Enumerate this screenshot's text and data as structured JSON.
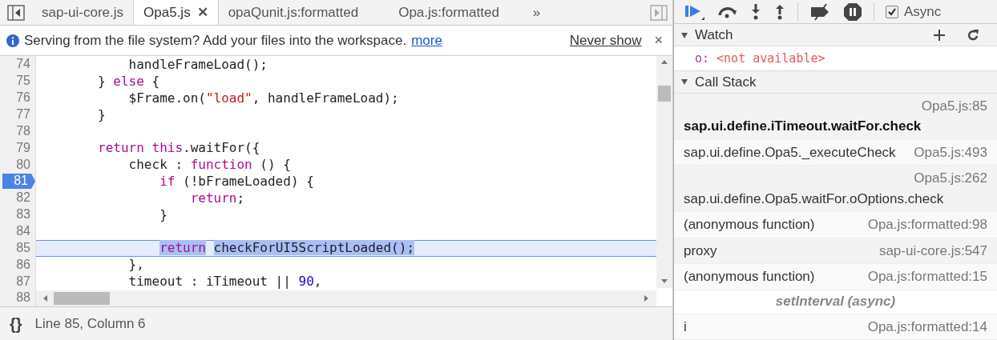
{
  "editor": {
    "tabs": [
      {
        "label": "sap-ui-core.js",
        "selected": false
      },
      {
        "label": "Opa5.js",
        "selected": true,
        "close": "✕"
      },
      {
        "label": "opaQunit.js:formatted",
        "selected": false
      },
      {
        "label": "Opa.js:formatted",
        "selected": false
      }
    ],
    "more_tabs": "»",
    "infobar": {
      "message": "Serving from the file system? Add your files into the workspace.",
      "link": "more",
      "dismiss": "Never show",
      "close": "×"
    },
    "lines": [
      {
        "number": "74",
        "tokens": [
          {
            "kind": "plain",
            "text": "            handleFrameLoad();"
          }
        ]
      },
      {
        "number": "75",
        "tokens": [
          {
            "kind": "plain",
            "text": "        } "
          },
          {
            "kind": "keyword",
            "text": "else"
          },
          {
            "kind": "plain",
            "text": " {"
          }
        ]
      },
      {
        "number": "76",
        "tokens": [
          {
            "kind": "plain",
            "text": "            $Frame.on("
          },
          {
            "kind": "string",
            "text": "\"load\""
          },
          {
            "kind": "plain",
            "text": ", handleFrameLoad);"
          }
        ]
      },
      {
        "number": "77",
        "tokens": [
          {
            "kind": "plain",
            "text": "        }"
          }
        ]
      },
      {
        "number": "78"
      },
      {
        "number": "79",
        "tokens": [
          {
            "kind": "keyword",
            "text": "        return this"
          },
          {
            "kind": "plain",
            "text": ".waitFor({"
          }
        ]
      },
      {
        "number": "80",
        "tokens": [
          {
            "kind": "plain",
            "text": "            check : "
          },
          {
            "kind": "keyword",
            "text": "function"
          },
          {
            "kind": "plain",
            "text": " () {"
          }
        ]
      },
      {
        "number": "81",
        "breakpoint": true,
        "current": false,
        "tokens": [
          {
            "kind": "keyword",
            "text": "                if"
          },
          {
            "kind": "plain",
            "text": " (!bFrameLoaded) {"
          }
        ]
      },
      {
        "number": "82",
        "tokens": [
          {
            "kind": "keyword",
            "text": "                    return"
          },
          {
            "kind": "plain",
            "text": ";"
          }
        ]
      },
      {
        "number": "83",
        "tokens": [
          {
            "kind": "plain",
            "text": "                }"
          }
        ]
      },
      {
        "number": "84"
      },
      {
        "number": "85",
        "breakpoint": false,
        "current": true,
        "tokens": [
          {
            "kind": "keyword",
            "text": "                return",
            "selected": true
          },
          {
            "kind": "plain",
            "text": " checkForUI5ScriptLoaded();",
            "selected": true
          }
        ]
      },
      {
        "number": "86",
        "tokens": [
          {
            "kind": "plain",
            "text": "            },"
          }
        ]
      },
      {
        "number": "87",
        "tokens": [
          {
            "kind": "plain",
            "text": "            timeout : iTimeout || "
          },
          {
            "kind": "number",
            "text": "90"
          },
          {
            "kind": "plain",
            "text": ","
          }
        ]
      },
      {
        "number": "88"
      }
    ],
    "format_button": "{}",
    "status": "Line 85, Column 6"
  },
  "debugger": {
    "async": {
      "label": "Async",
      "checked": true
    },
    "watch": {
      "title": "Watch",
      "expanded": true,
      "items": [
        {
          "name": "o:",
          "value": "<not available>"
        }
      ]
    },
    "call_stack": {
      "title": "Call Stack",
      "expanded": true,
      "frames": [
        {
          "kind": "frame",
          "name": "sap.ui.define.iTimeout.waitFor.check",
          "location": "Opa5.js:85",
          "selected": true
        },
        {
          "kind": "frame",
          "name": "sap.ui.define.Opa5._executeCheck",
          "location": "Opa5.js:493",
          "selected": false
        },
        {
          "kind": "frame",
          "name": "sap.ui.define.Opa5.waitFor.oOptions.check",
          "location": "Opa5.js:262",
          "selected": false
        },
        {
          "kind": "frame",
          "name": "(anonymous function)",
          "location": "Opa.js:formatted:98",
          "selected": false
        },
        {
          "kind": "frame",
          "name": "proxy",
          "location": "sap-ui-core.js:547",
          "selected": false
        },
        {
          "kind": "frame",
          "name": "(anonymous function)",
          "location": "Opa.js:formatted:15",
          "selected": false
        },
        {
          "kind": "async",
          "name": "setInterval (async)"
        },
        {
          "kind": "frame",
          "name": "i",
          "location": "Opa.js:formatted:14",
          "selected": false
        }
      ]
    }
  }
}
